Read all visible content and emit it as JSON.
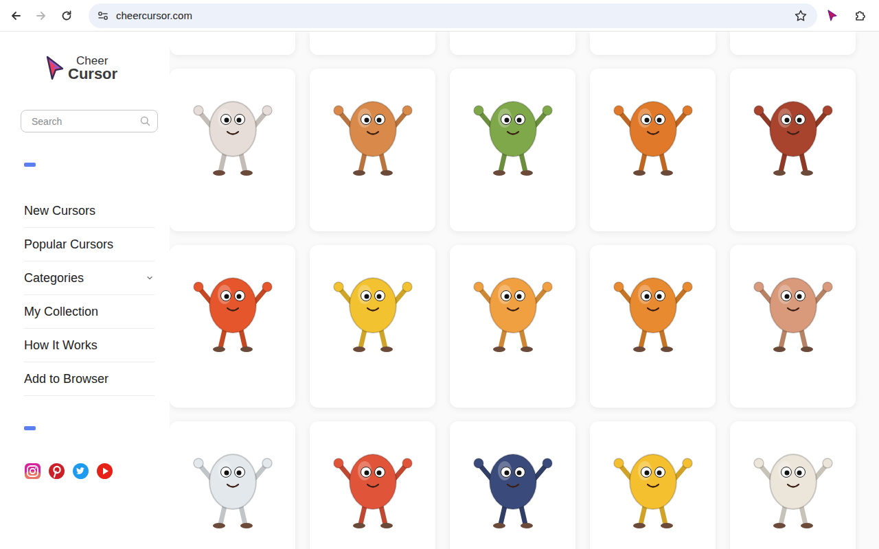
{
  "browser": {
    "url": "cheercursor.com",
    "back_enabled": true,
    "forward_enabled": false,
    "bookmarked": false
  },
  "logo": {
    "line1": "Cheer",
    "line2": "Cursor"
  },
  "search": {
    "placeholder": "Search"
  },
  "nav": [
    {
      "label": "New Cursors",
      "expandable": false
    },
    {
      "label": "Popular Cursors",
      "expandable": false
    },
    {
      "label": "Categories",
      "expandable": true
    },
    {
      "label": "My Collection",
      "expandable": false
    },
    {
      "label": "How It Works",
      "expandable": false
    },
    {
      "label": "Add to Browser",
      "expandable": false
    }
  ],
  "social": [
    {
      "kind": "instagram",
      "color": "#d6249f"
    },
    {
      "kind": "pinterest",
      "color": "#cb2027"
    },
    {
      "kind": "twitter",
      "color": "#1d9bf0"
    },
    {
      "kind": "youtube",
      "color": "#e62117"
    }
  ],
  "cards": [
    {
      "kind": "cut"
    },
    {
      "kind": "cut"
    },
    {
      "kind": "cut"
    },
    {
      "kind": "cut"
    },
    {
      "kind": "cut"
    },
    {
      "kind": "figure",
      "color": "#e6ddd8"
    },
    {
      "kind": "figure",
      "color": "#d98a4a"
    },
    {
      "kind": "figure",
      "color": "#7fa84a"
    },
    {
      "kind": "figure",
      "color": "#e07a2a"
    },
    {
      "kind": "figure",
      "color": "#a8442e"
    },
    {
      "kind": "figure",
      "color": "#e5562c"
    },
    {
      "kind": "figure",
      "color": "#f2c230"
    },
    {
      "kind": "figure",
      "color": "#f0a040"
    },
    {
      "kind": "figure",
      "color": "#e88a30"
    },
    {
      "kind": "figure",
      "color": "#d89a7a"
    },
    {
      "kind": "figure",
      "color": "#e3e8ec"
    },
    {
      "kind": "figure",
      "color": "#e0553a"
    },
    {
      "kind": "figure",
      "color": "#3a4a7a"
    },
    {
      "kind": "figure",
      "color": "#f5c030"
    },
    {
      "kind": "figure",
      "color": "#ece6da"
    }
  ]
}
